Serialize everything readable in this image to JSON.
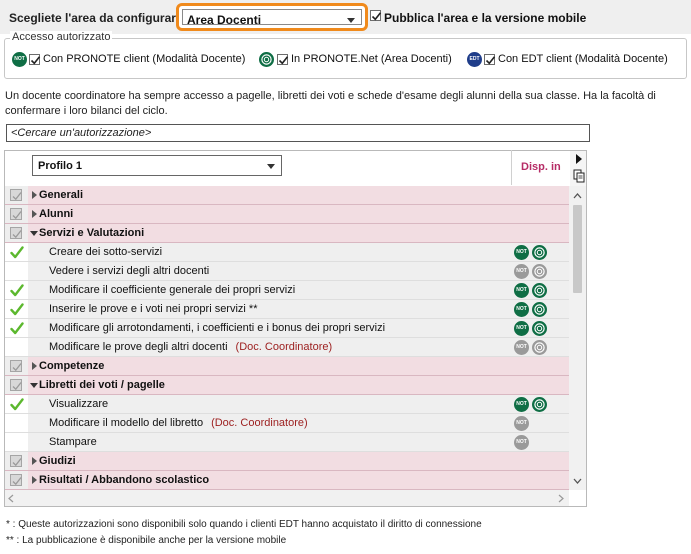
{
  "top": {
    "area_label": "Scegliete l'area da configurare",
    "area_selected": "Area Docenti",
    "publish_label": "Pubblica l'area e la versione mobile",
    "publish_checked": true
  },
  "access": {
    "legend": "Accesso autorizzato",
    "clients": [
      {
        "badge": "NOT",
        "label": "Con PRONOTE client (Modalità Docente)",
        "checked": true,
        "icon": "pronote-client-icon",
        "color": "#0f6e45"
      },
      {
        "badge": "",
        "label": "In PRONOTE.Net (Area Docenti)",
        "checked": true,
        "icon": "pronote-net-icon",
        "color": "#0f6e45"
      },
      {
        "badge": "EDT",
        "label": "Con EDT client (Modalità Docente)",
        "checked": true,
        "icon": "edt-client-icon",
        "color": "#1f3d8a"
      }
    ]
  },
  "description": "Un docente coordinatore ha sempre accesso a pagelle, libretti dei voti e schede d'esame degli alunni della sua classe. Ha la facoltà di confermare i loro bilanci del ciclo.",
  "search": {
    "placeholder": "<Cercare un'autorizzazione>"
  },
  "table": {
    "profile": "Profilo 1",
    "disp_header": "Disp. in",
    "badge_text": "NOT",
    "rows": [
      {
        "type": "group",
        "label": "Generali",
        "expanded": false
      },
      {
        "type": "group",
        "label": "Alunni",
        "expanded": false
      },
      {
        "type": "group",
        "label": "Servizi e Valutazioni",
        "expanded": true
      },
      {
        "type": "item",
        "label": "Creare dei sotto-servizi",
        "role": "",
        "checked": true,
        "not_active": true,
        "net_active": true
      },
      {
        "type": "item",
        "label": "Vedere i servizi degli altri docenti",
        "role": "",
        "checked": false,
        "not_active": false,
        "net_active": false
      },
      {
        "type": "item",
        "label": "Modificare il coefficiente generale dei propri servizi",
        "role": "",
        "checked": true,
        "not_active": true,
        "net_active": true
      },
      {
        "type": "item",
        "label": "Inserire le prove e i voti nei propri servizi **",
        "role": "",
        "checked": true,
        "not_active": true,
        "net_active": true
      },
      {
        "type": "item",
        "label": "Modificare gli arrotondamenti, i coefficienti e i bonus dei propri servizi",
        "role": "",
        "checked": true,
        "not_active": true,
        "net_active": true
      },
      {
        "type": "item",
        "label": "Modificare le prove degli altri docenti",
        "role": "(Doc. Coordinatore)",
        "checked": false,
        "not_active": false,
        "net_active": false
      },
      {
        "type": "group",
        "label": "Competenze",
        "expanded": false
      },
      {
        "type": "group",
        "label": "Libretti dei voti / pagelle",
        "expanded": true
      },
      {
        "type": "item",
        "label": "Visualizzare",
        "role": "",
        "checked": true,
        "not_active": true,
        "net_active": true
      },
      {
        "type": "item",
        "label": "Modificare il modello del libretto",
        "role": "(Doc. Coordinatore)",
        "checked": false,
        "not_active": false,
        "net_active": null
      },
      {
        "type": "item",
        "label": "Stampare",
        "role": "",
        "checked": false,
        "not_active": false,
        "net_active": null
      },
      {
        "type": "group",
        "label": "Giudizi",
        "expanded": false
      },
      {
        "type": "group",
        "label": "Risultati / Abbandono scolastico",
        "expanded": false
      }
    ]
  },
  "footnotes": [
    "* : Queste autorizzazioni sono disponibili solo quando i clienti EDT hanno acquistato il diritto di connessione",
    "** : La pubblicazione è disponibile anche per la versione mobile"
  ],
  "colors": {
    "accent_orange": "#f08a1c",
    "group_row": "#f2dde2",
    "disp_header": "#b62c66",
    "active_badge": "#0f6e45",
    "inactive_badge": "#9a9a9a",
    "check_green": "#5cb82e",
    "role_text": "#9c1e1e"
  }
}
